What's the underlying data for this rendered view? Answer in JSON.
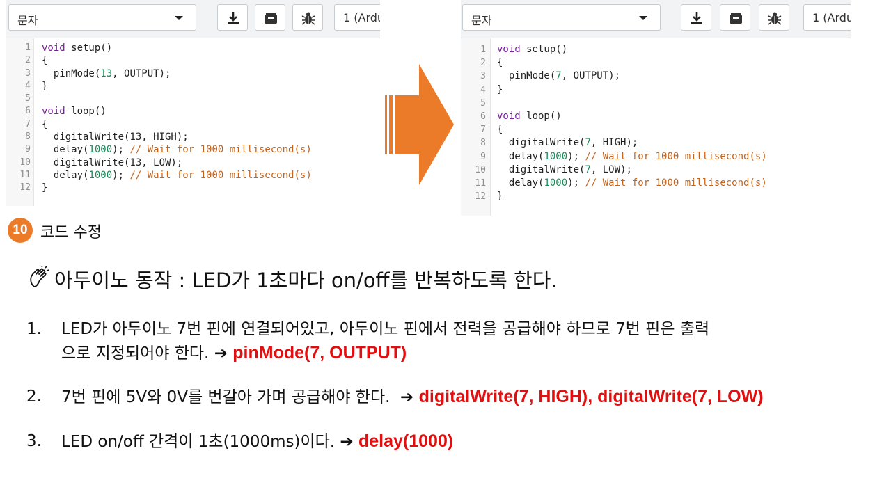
{
  "left_panel": {
    "encoding_dropdown": "문자",
    "board_selector": "1 (Ardu",
    "code_lines": [
      {
        "n": "1",
        "parts": [
          [
            "kw",
            "void"
          ],
          [
            "t",
            " setup()"
          ]
        ]
      },
      {
        "n": "2",
        "parts": [
          [
            "t",
            "{"
          ]
        ]
      },
      {
        "n": "3",
        "parts": [
          [
            "t",
            "  pinMode("
          ],
          [
            "num",
            "13"
          ],
          [
            "t",
            ", OUTPUT);"
          ]
        ]
      },
      {
        "n": "4",
        "parts": [
          [
            "t",
            "}"
          ]
        ]
      },
      {
        "n": "5",
        "parts": []
      },
      {
        "n": "6",
        "parts": [
          [
            "kw",
            "void"
          ],
          [
            "t",
            " loop()"
          ]
        ]
      },
      {
        "n": "7",
        "parts": [
          [
            "t",
            "{"
          ]
        ]
      },
      {
        "n": "8",
        "parts": [
          [
            "t",
            "  digitalWrite(13, HIGH);"
          ]
        ]
      },
      {
        "n": "9",
        "parts": [
          [
            "t",
            "  delay("
          ],
          [
            "num",
            "1000"
          ],
          [
            "t",
            "); "
          ],
          [
            "cm",
            "// Wait for 1000 millisecond(s)"
          ]
        ]
      },
      {
        "n": "10",
        "parts": [
          [
            "t",
            "  digitalWrite(13, LOW);"
          ]
        ]
      },
      {
        "n": "11",
        "parts": [
          [
            "t",
            "  delay("
          ],
          [
            "num",
            "1000"
          ],
          [
            "t",
            "); "
          ],
          [
            "cm",
            "// Wait for 1000 millisecond(s)"
          ]
        ]
      },
      {
        "n": "12",
        "parts": [
          [
            "t",
            "}"
          ]
        ]
      }
    ]
  },
  "right_panel": {
    "encoding_dropdown": "문자",
    "board_selector": "1 (Ardu",
    "code_lines": [
      {
        "n": "1",
        "parts": [
          [
            "kw",
            "void"
          ],
          [
            "t",
            " setup()"
          ]
        ]
      },
      {
        "n": "2",
        "parts": [
          [
            "t",
            "{"
          ]
        ]
      },
      {
        "n": "3",
        "parts": [
          [
            "t",
            "  pinMode("
          ],
          [
            "num",
            "7"
          ],
          [
            "t",
            ", OUTPUT);"
          ]
        ]
      },
      {
        "n": "4",
        "parts": [
          [
            "t",
            "}"
          ]
        ]
      },
      {
        "n": "5",
        "parts": []
      },
      {
        "n": "6",
        "parts": [
          [
            "kw",
            "void"
          ],
          [
            "t",
            " loop()"
          ]
        ]
      },
      {
        "n": "7",
        "parts": [
          [
            "t",
            "{"
          ]
        ]
      },
      {
        "n": "8",
        "parts": [
          [
            "t",
            "  digitalWrite("
          ],
          [
            "num",
            "7"
          ],
          [
            "t",
            ", HIGH);"
          ]
        ]
      },
      {
        "n": "9",
        "parts": [
          [
            "t",
            "  delay("
          ],
          [
            "num",
            "1000"
          ],
          [
            "t",
            "); "
          ],
          [
            "cm",
            "// Wait for 1000 millisecond(s)"
          ]
        ]
      },
      {
        "n": "10",
        "parts": [
          [
            "t",
            "  digitalWrite("
          ],
          [
            "num",
            "7"
          ],
          [
            "t",
            ", LOW);"
          ]
        ]
      },
      {
        "n": "11",
        "parts": [
          [
            "t",
            "  delay("
          ],
          [
            "num",
            "1000"
          ],
          [
            "t",
            "); "
          ],
          [
            "cm",
            "// Wait for 1000 millisecond(s)"
          ]
        ]
      },
      {
        "n": "12",
        "parts": [
          [
            "t",
            "}"
          ]
        ]
      }
    ]
  },
  "toolbar_icons": [
    "download-icon",
    "serial-monitor-icon",
    "debug-bug-icon"
  ],
  "step": {
    "number": "10",
    "title": "코드 수정"
  },
  "heading": "아두이노 동작 :  LED가 1초마다 on/off를 반복하도록 한다.",
  "items": [
    {
      "num": "1.",
      "line1": "LED가 아두이노 7번 핀에 연결되어있고, 아두이노 핀에서 전력을 공급해야 하므로 7번 핀은 출력",
      "line2": "으로 지정되어야 한다.",
      "arrow": "➔",
      "code": "pinMode(7, OUTPUT)"
    },
    {
      "num": "2.",
      "text": "7번 핀에 5V와 0V를 번갈아 가며 공급해야 한다.",
      "arrow": "➔",
      "code": "digitalWrite(7, HIGH), digitalWrite(7, LOW)"
    },
    {
      "num": "3.",
      "text": "LED on/off 간격이 1초(1000ms)이다.",
      "arrow": "➔",
      "code": "delay(1000)"
    }
  ],
  "colors": {
    "accent_orange": "#ec7b29",
    "highlight_red": "#e10f0f",
    "keyword": "#7a1e9e",
    "number": "#1d8a5a",
    "comment": "#c3631c"
  }
}
